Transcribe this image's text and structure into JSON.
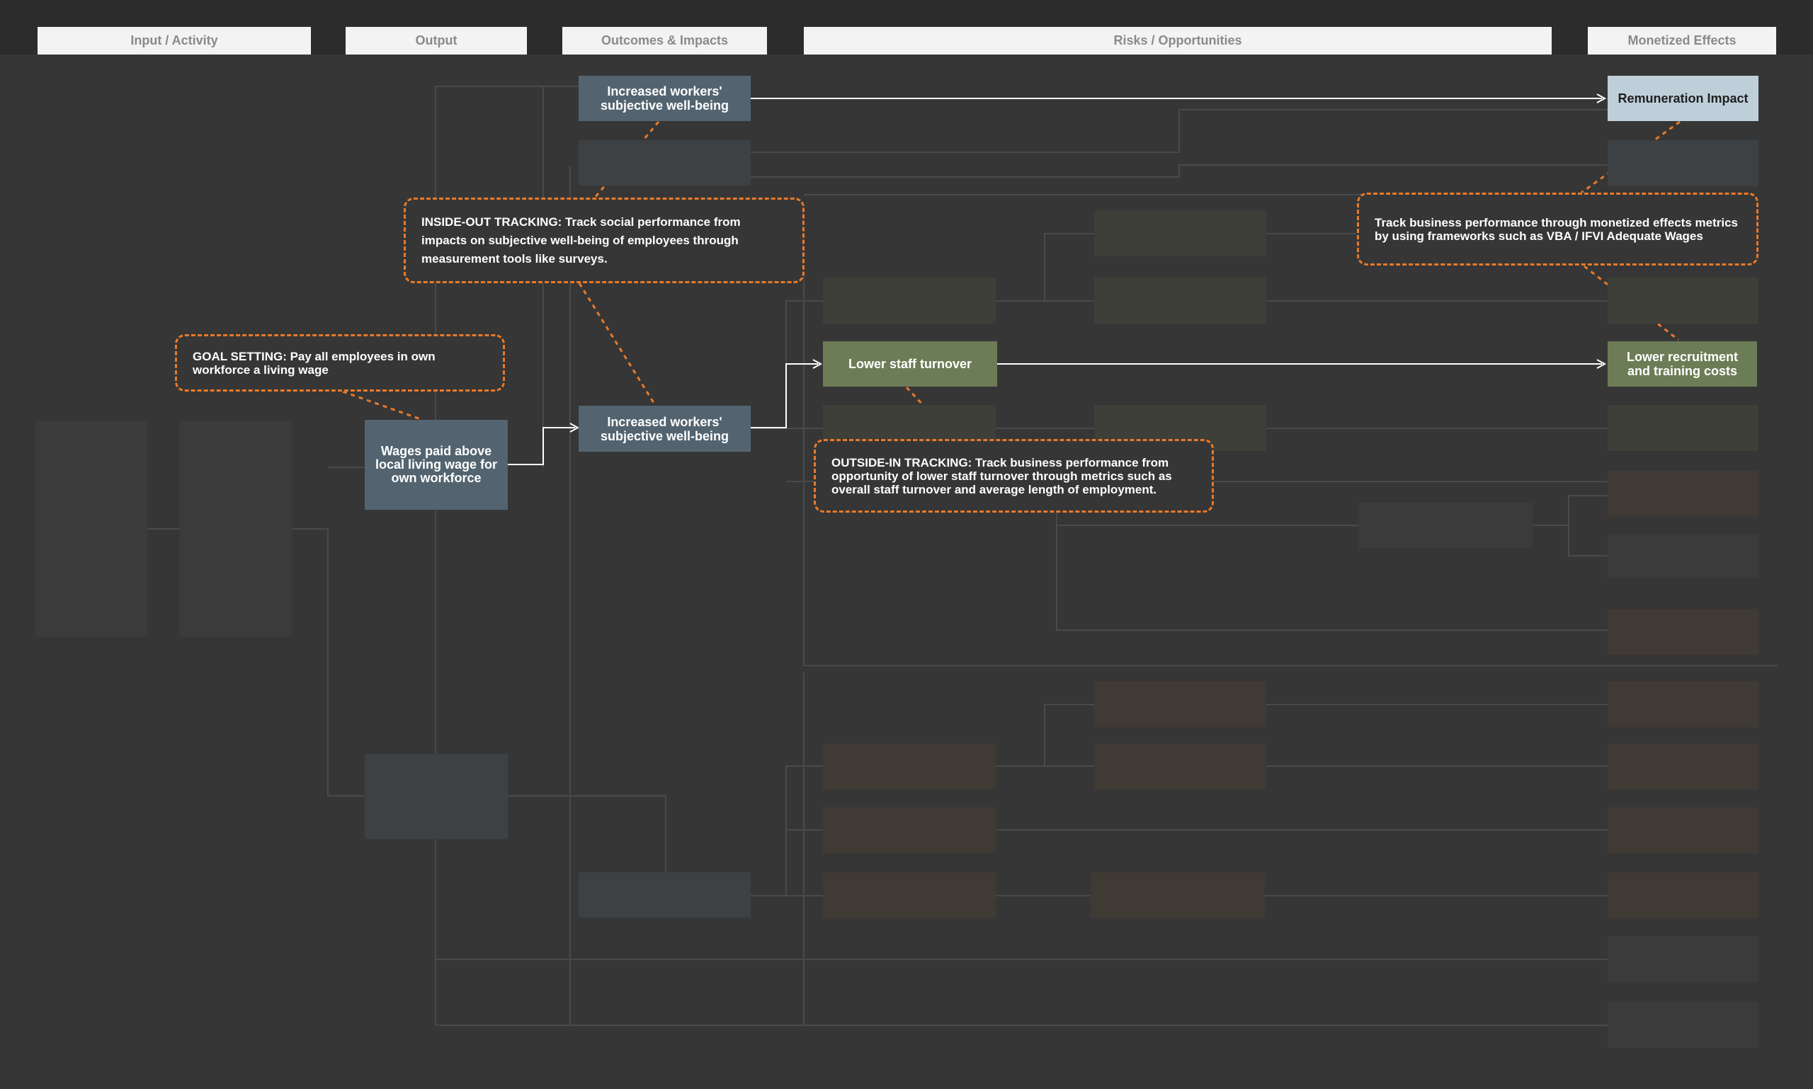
{
  "columns": [
    "Input / Activity",
    "Output",
    "Outcomes & Impacts",
    "Risks / Opportunities",
    "Monetized Effects"
  ],
  "nodes": {
    "outcome_top": "Increased workers' subjective well-being",
    "monetized_top": "Remuneration Impact",
    "wages_paid": "Wages paid above local living wage for own workforce",
    "outcome_mid": "Increased workers' subjective well-being",
    "lower_turnover": "Lower staff turnover",
    "monetized_turnover": "Lower recruitment and training costs"
  },
  "notes": {
    "inside_out": "INSIDE-OUT TRACKING: Track social performance from impacts on subjective well-being of employees through measurement tools like surveys.",
    "goal_setting": "GOAL SETTING: Pay all employees in own workforce a living wage",
    "monetized": "Track business performance through monetized effects metrics by using frameworks such as VBA / IFVI Adequate Wages",
    "outside_in": "OUTSIDE-IN TRACKING: Track business performance from opportunity of lower staff turnover through metrics such as overall staff turnover and average length of employment."
  },
  "colors": {
    "background": "#363636",
    "header_bg": "#f3f3f3",
    "header_text": "#8a8a8a",
    "slate_node": "#536470",
    "light_slate_node": "#bfcfda",
    "olive_node": "#6c7c56",
    "dashed_border": "#e87a2a",
    "connector": "#ffffff"
  }
}
